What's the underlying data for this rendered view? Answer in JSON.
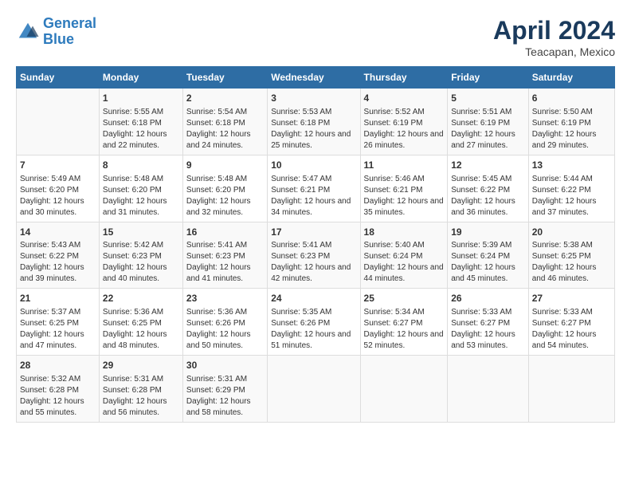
{
  "header": {
    "logo_line1": "General",
    "logo_line2": "Blue",
    "month_year": "April 2024",
    "location": "Teacapan, Mexico"
  },
  "days_of_week": [
    "Sunday",
    "Monday",
    "Tuesday",
    "Wednesday",
    "Thursday",
    "Friday",
    "Saturday"
  ],
  "weeks": [
    [
      {
        "day": "",
        "sunrise": "",
        "sunset": "",
        "daylight": ""
      },
      {
        "day": "1",
        "sunrise": "Sunrise: 5:55 AM",
        "sunset": "Sunset: 6:18 PM",
        "daylight": "Daylight: 12 hours and 22 minutes."
      },
      {
        "day": "2",
        "sunrise": "Sunrise: 5:54 AM",
        "sunset": "Sunset: 6:18 PM",
        "daylight": "Daylight: 12 hours and 24 minutes."
      },
      {
        "day": "3",
        "sunrise": "Sunrise: 5:53 AM",
        "sunset": "Sunset: 6:18 PM",
        "daylight": "Daylight: 12 hours and 25 minutes."
      },
      {
        "day": "4",
        "sunrise": "Sunrise: 5:52 AM",
        "sunset": "Sunset: 6:19 PM",
        "daylight": "Daylight: 12 hours and 26 minutes."
      },
      {
        "day": "5",
        "sunrise": "Sunrise: 5:51 AM",
        "sunset": "Sunset: 6:19 PM",
        "daylight": "Daylight: 12 hours and 27 minutes."
      },
      {
        "day": "6",
        "sunrise": "Sunrise: 5:50 AM",
        "sunset": "Sunset: 6:19 PM",
        "daylight": "Daylight: 12 hours and 29 minutes."
      }
    ],
    [
      {
        "day": "7",
        "sunrise": "Sunrise: 5:49 AM",
        "sunset": "Sunset: 6:20 PM",
        "daylight": "Daylight: 12 hours and 30 minutes."
      },
      {
        "day": "8",
        "sunrise": "Sunrise: 5:48 AM",
        "sunset": "Sunset: 6:20 PM",
        "daylight": "Daylight: 12 hours and 31 minutes."
      },
      {
        "day": "9",
        "sunrise": "Sunrise: 5:48 AM",
        "sunset": "Sunset: 6:20 PM",
        "daylight": "Daylight: 12 hours and 32 minutes."
      },
      {
        "day": "10",
        "sunrise": "Sunrise: 5:47 AM",
        "sunset": "Sunset: 6:21 PM",
        "daylight": "Daylight: 12 hours and 34 minutes."
      },
      {
        "day": "11",
        "sunrise": "Sunrise: 5:46 AM",
        "sunset": "Sunset: 6:21 PM",
        "daylight": "Daylight: 12 hours and 35 minutes."
      },
      {
        "day": "12",
        "sunrise": "Sunrise: 5:45 AM",
        "sunset": "Sunset: 6:22 PM",
        "daylight": "Daylight: 12 hours and 36 minutes."
      },
      {
        "day": "13",
        "sunrise": "Sunrise: 5:44 AM",
        "sunset": "Sunset: 6:22 PM",
        "daylight": "Daylight: 12 hours and 37 minutes."
      }
    ],
    [
      {
        "day": "14",
        "sunrise": "Sunrise: 5:43 AM",
        "sunset": "Sunset: 6:22 PM",
        "daylight": "Daylight: 12 hours and 39 minutes."
      },
      {
        "day": "15",
        "sunrise": "Sunrise: 5:42 AM",
        "sunset": "Sunset: 6:23 PM",
        "daylight": "Daylight: 12 hours and 40 minutes."
      },
      {
        "day": "16",
        "sunrise": "Sunrise: 5:41 AM",
        "sunset": "Sunset: 6:23 PM",
        "daylight": "Daylight: 12 hours and 41 minutes."
      },
      {
        "day": "17",
        "sunrise": "Sunrise: 5:41 AM",
        "sunset": "Sunset: 6:23 PM",
        "daylight": "Daylight: 12 hours and 42 minutes."
      },
      {
        "day": "18",
        "sunrise": "Sunrise: 5:40 AM",
        "sunset": "Sunset: 6:24 PM",
        "daylight": "Daylight: 12 hours and 44 minutes."
      },
      {
        "day": "19",
        "sunrise": "Sunrise: 5:39 AM",
        "sunset": "Sunset: 6:24 PM",
        "daylight": "Daylight: 12 hours and 45 minutes."
      },
      {
        "day": "20",
        "sunrise": "Sunrise: 5:38 AM",
        "sunset": "Sunset: 6:25 PM",
        "daylight": "Daylight: 12 hours and 46 minutes."
      }
    ],
    [
      {
        "day": "21",
        "sunrise": "Sunrise: 5:37 AM",
        "sunset": "Sunset: 6:25 PM",
        "daylight": "Daylight: 12 hours and 47 minutes."
      },
      {
        "day": "22",
        "sunrise": "Sunrise: 5:36 AM",
        "sunset": "Sunset: 6:25 PM",
        "daylight": "Daylight: 12 hours and 48 minutes."
      },
      {
        "day": "23",
        "sunrise": "Sunrise: 5:36 AM",
        "sunset": "Sunset: 6:26 PM",
        "daylight": "Daylight: 12 hours and 50 minutes."
      },
      {
        "day": "24",
        "sunrise": "Sunrise: 5:35 AM",
        "sunset": "Sunset: 6:26 PM",
        "daylight": "Daylight: 12 hours and 51 minutes."
      },
      {
        "day": "25",
        "sunrise": "Sunrise: 5:34 AM",
        "sunset": "Sunset: 6:27 PM",
        "daylight": "Daylight: 12 hours and 52 minutes."
      },
      {
        "day": "26",
        "sunrise": "Sunrise: 5:33 AM",
        "sunset": "Sunset: 6:27 PM",
        "daylight": "Daylight: 12 hours and 53 minutes."
      },
      {
        "day": "27",
        "sunrise": "Sunrise: 5:33 AM",
        "sunset": "Sunset: 6:27 PM",
        "daylight": "Daylight: 12 hours and 54 minutes."
      }
    ],
    [
      {
        "day": "28",
        "sunrise": "Sunrise: 5:32 AM",
        "sunset": "Sunset: 6:28 PM",
        "daylight": "Daylight: 12 hours and 55 minutes."
      },
      {
        "day": "29",
        "sunrise": "Sunrise: 5:31 AM",
        "sunset": "Sunset: 6:28 PM",
        "daylight": "Daylight: 12 hours and 56 minutes."
      },
      {
        "day": "30",
        "sunrise": "Sunrise: 5:31 AM",
        "sunset": "Sunset: 6:29 PM",
        "daylight": "Daylight: 12 hours and 58 minutes."
      },
      {
        "day": "",
        "sunrise": "",
        "sunset": "",
        "daylight": ""
      },
      {
        "day": "",
        "sunrise": "",
        "sunset": "",
        "daylight": ""
      },
      {
        "day": "",
        "sunrise": "",
        "sunset": "",
        "daylight": ""
      },
      {
        "day": "",
        "sunrise": "",
        "sunset": "",
        "daylight": ""
      }
    ]
  ]
}
